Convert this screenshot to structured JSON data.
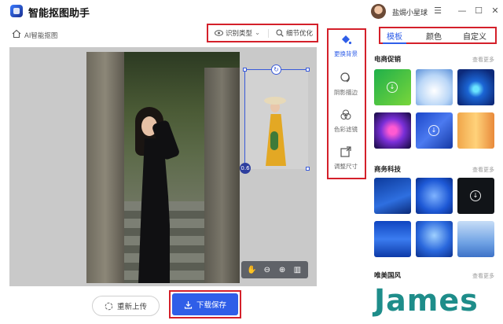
{
  "app": {
    "title": "智能抠图助手",
    "user_name": "盐焗小星球",
    "window_controls": [
      "menu-icon",
      "minimize-icon",
      "maximize-icon",
      "close-icon"
    ]
  },
  "toolbar": {
    "breadcrumb": "AI智能抠图",
    "recognize_type": "识别类型",
    "refine": "细节优化"
  },
  "canvas": {
    "zoom_tools": [
      "hand-icon",
      "zoom-out-icon",
      "zoom-in-icon",
      "compare-icon"
    ],
    "size_badge": "0.6"
  },
  "actions": {
    "reupload": "重新上传",
    "download": "下载保存"
  },
  "tools": [
    {
      "label": "更换背景",
      "icon": "paint-bucket-icon",
      "active": true
    },
    {
      "label": "阴影描边",
      "icon": "shadow-icon",
      "active": false
    },
    {
      "label": "色彩滤镜",
      "icon": "filter-icon",
      "active": false
    },
    {
      "label": "调整尺寸",
      "icon": "resize-icon",
      "active": false
    }
  ],
  "panel": {
    "tabs": [
      "模板",
      "颜色",
      "自定义"
    ],
    "active_tab": "模板",
    "sections": [
      {
        "title": "电商促销",
        "more": "查看更多"
      },
      {
        "title": "商务科技",
        "more": "查看更多"
      },
      {
        "title": "唯美国风",
        "more": "查看更多"
      }
    ]
  },
  "colors": {
    "accent": "#2f5ee8",
    "highlight_border": "#d4202a",
    "watermark": "#1e8d8a"
  },
  "watermark": "James"
}
